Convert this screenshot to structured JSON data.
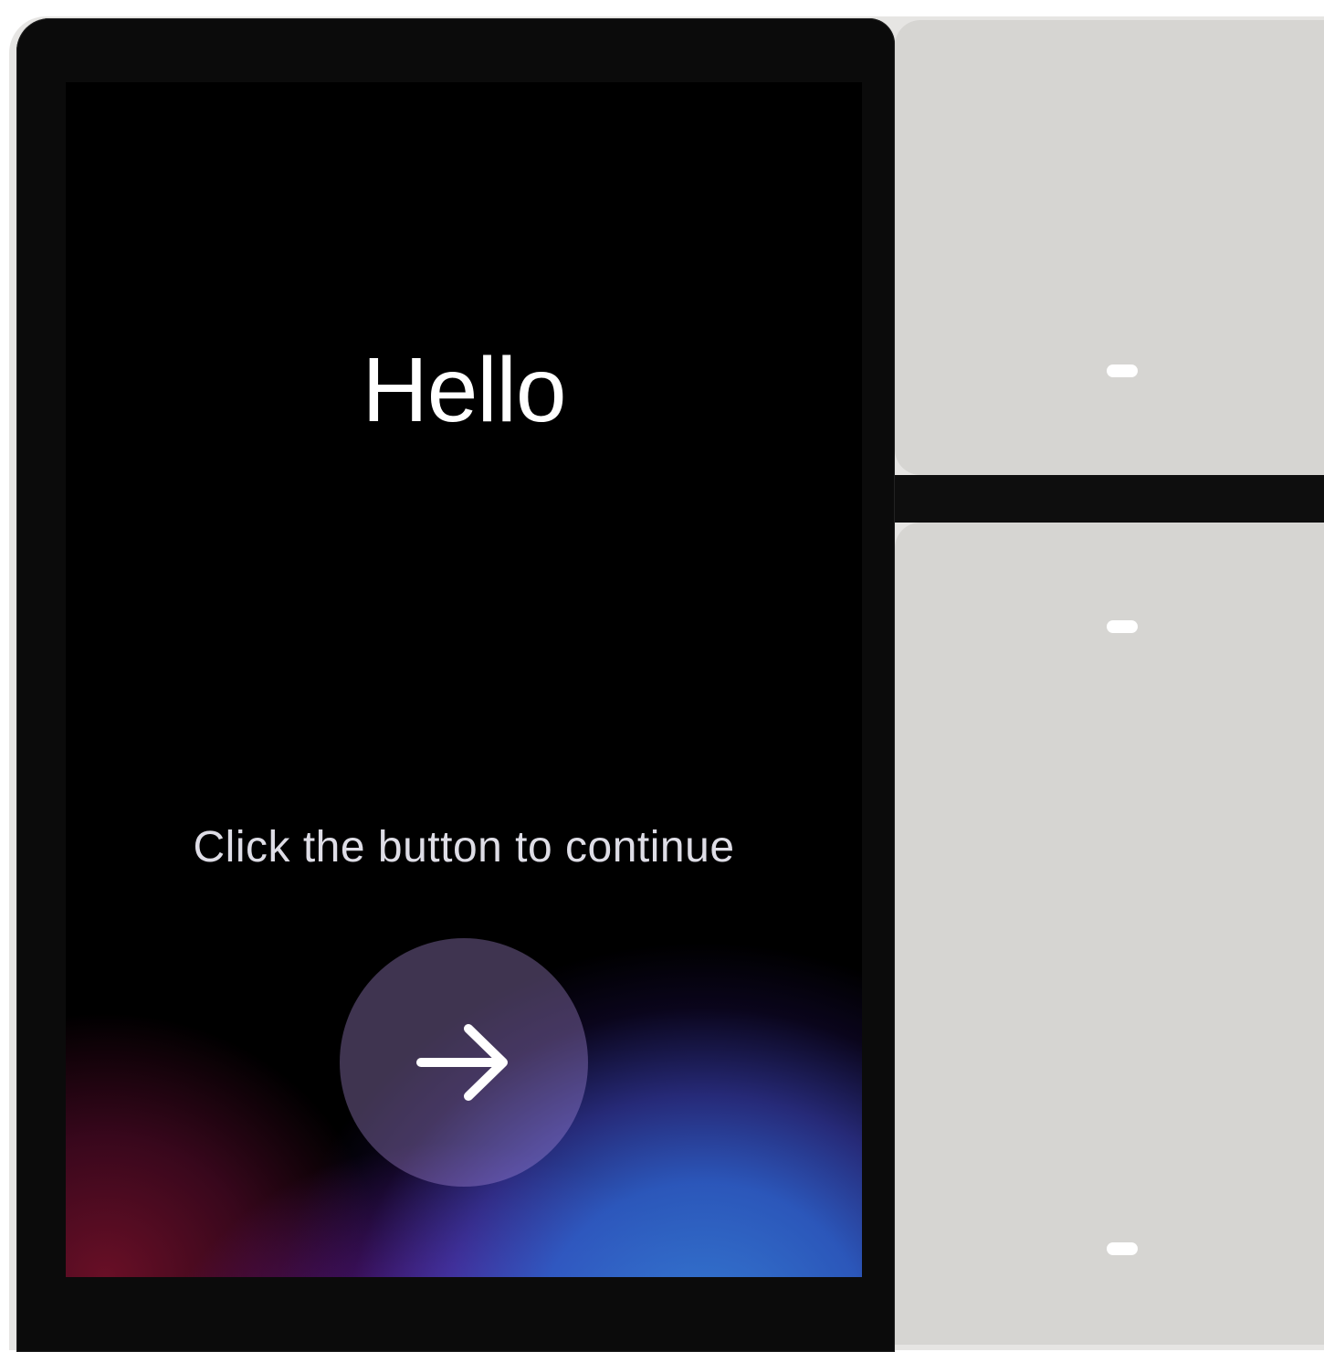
{
  "screen": {
    "greeting": "Hello",
    "instruction": "Click the button to continue",
    "continue_button_icon": "arrow-right-icon"
  },
  "side_panels": {
    "top_panel_indicator": "dash-icon",
    "bottom_panel_indicators": [
      "dash-icon",
      "dash-icon"
    ]
  },
  "colors": {
    "bezel": "#0b0b0b",
    "panel": "#d6d5d2",
    "accent_blue": "#367cd6",
    "accent_purple": "#7828aa",
    "accent_red": "#6e1028"
  }
}
